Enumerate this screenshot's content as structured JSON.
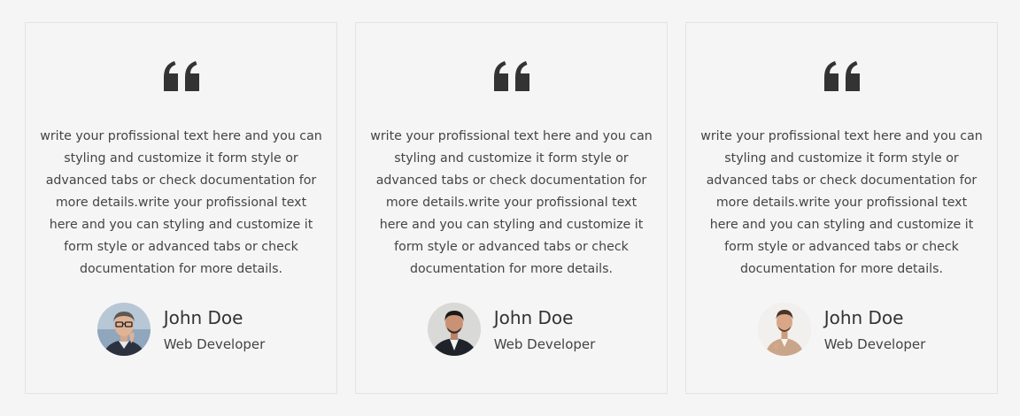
{
  "colors": {
    "background": "#f5f5f5",
    "card_border": "#e3e3e3",
    "quote_icon": "#333333",
    "text": "#444444"
  },
  "testimonials": [
    {
      "quote_icon": "double-quote-icon",
      "text": "write your profissional text here and you can styling and customize it form style or advanced tabs or check documentation for more details.write your profissional text here and you can styling and customize it form style or advanced tabs or check documentation for more details.",
      "name": "John Doe",
      "role": "Web Developer",
      "avatar": "avatar-man-glasses"
    },
    {
      "quote_icon": "double-quote-icon",
      "text": "write your profissional text here and you can styling and customize it form style or advanced tabs or check documentation for more details.write your profissional text here and you can styling and customize it form style or advanced tabs or check documentation for more details.",
      "name": "John Doe",
      "role": "Web Developer",
      "avatar": "avatar-man-suit"
    },
    {
      "quote_icon": "double-quote-icon",
      "text": "write your profissional text here and you can styling and customize it form style or advanced tabs or check documentation for more details.write your profissional text here and you can styling and customize it form style or advanced tabs or check documentation for more details.",
      "name": "John Doe",
      "role": "Web Developer",
      "avatar": "avatar-man-beige-jacket"
    }
  ]
}
